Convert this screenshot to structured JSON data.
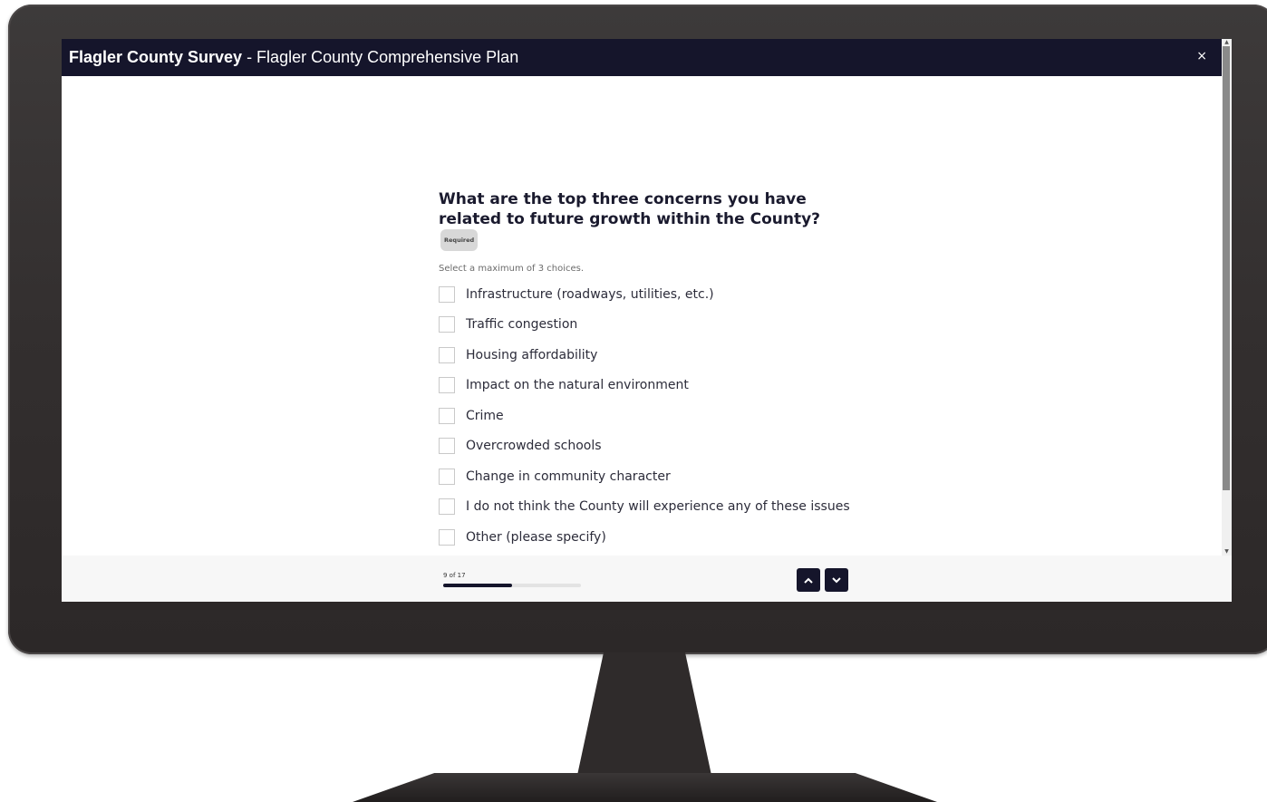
{
  "window": {
    "title_bold": "Flagler County Survey",
    "title_rest": " - Flagler County Comprehensive Plan",
    "close_label": "×"
  },
  "question": {
    "title": "What are the top three concerns you have related to future growth within the County?",
    "required_label": "Required",
    "hint": "Select a maximum of 3 choices.",
    "options": [
      {
        "label": "Infrastructure (roadways, utilities, etc.)",
        "checked": false
      },
      {
        "label": "Traffic congestion",
        "checked": false
      },
      {
        "label": "Housing affordability",
        "checked": false
      },
      {
        "label": "Impact on the natural environment",
        "checked": false
      },
      {
        "label": "Crime",
        "checked": false
      },
      {
        "label": "Overcrowded schools",
        "checked": false
      },
      {
        "label": "Change in community character",
        "checked": false
      },
      {
        "label": "I do not think the County will experience any of these issues",
        "checked": false
      },
      {
        "label": "Other (please specify)",
        "checked": false
      }
    ]
  },
  "footer": {
    "progress_text": "9 of 17",
    "progress_fraction": 0.5,
    "up_icon": "chevron-up-icon",
    "down_icon": "chevron-down-icon"
  },
  "colors": {
    "header_bg": "#15152b",
    "accent": "#15152b"
  }
}
